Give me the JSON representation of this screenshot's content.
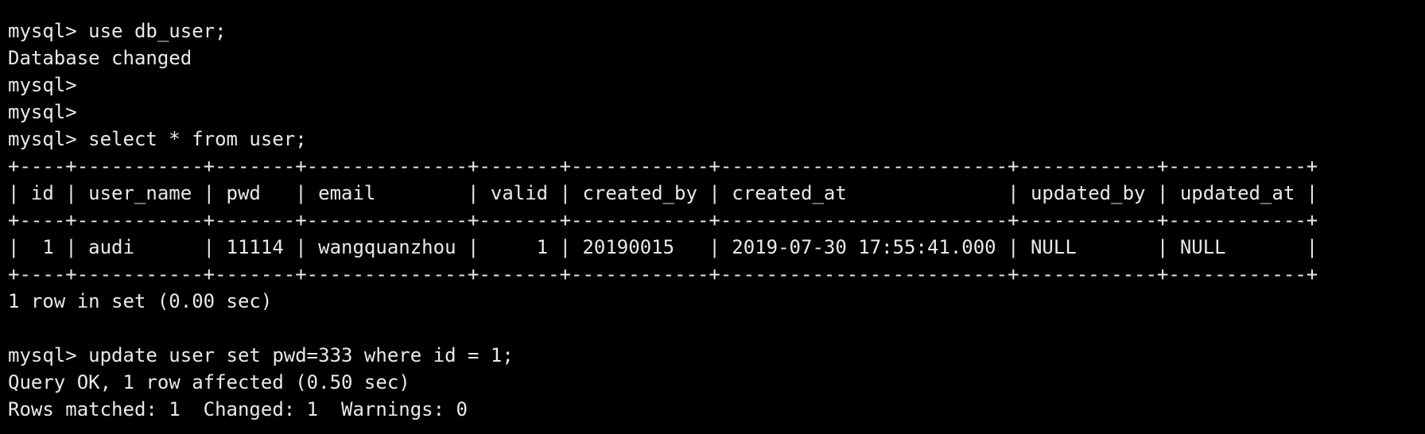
{
  "colors": {
    "background": "#000000",
    "foreground": "#e9e9e9"
  },
  "lines": [
    "mysql> use db_user;",
    "Database changed",
    "mysql>",
    "mysql>",
    "mysql> select * from user;",
    "+----+-----------+-------+--------------+-------+------------+-------------------------+------------+------------+",
    "| id | user_name | pwd   | email        | valid | created_by | created_at              | updated_by | updated_at |",
    "+----+-----------+-------+--------------+-------+------------+-------------------------+------------+------------+",
    "|  1 | audi      | 11114 | wangquanzhou |     1 | 20190015   | 2019-07-30 17:55:41.000 | NULL       | NULL       |",
    "+----+-----------+-------+--------------+-------+------------+-------------------------+------------+------------+",
    "1 row in set (0.00 sec)",
    "",
    "mysql> update user set pwd=333 where id = 1;",
    "Query OK, 1 row affected (0.50 sec)",
    "Rows matched: 1  Changed: 1  Warnings: 0"
  ]
}
